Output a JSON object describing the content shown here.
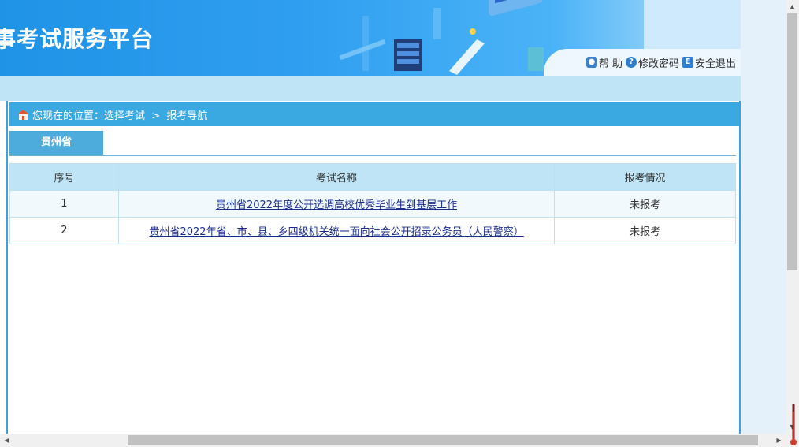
{
  "header": {
    "title": "事考试服务平台",
    "links": [
      {
        "icon": "lock-icon",
        "label": "帮 助"
      },
      {
        "icon": "question-icon",
        "label": "修改密码"
      },
      {
        "icon": "exit-icon",
        "label": "安全退出"
      }
    ]
  },
  "breadcrumb": {
    "icon": "home-icon",
    "label": "您现在的位置：选择考试  >  报考导航"
  },
  "tabs": [
    {
      "label": "贵州省",
      "active": true
    }
  ],
  "table": {
    "columns": [
      "序号",
      "考试名称",
      "报考情况"
    ],
    "rows": [
      {
        "index": "1",
        "name": "贵州省2022年度公开选调高校优秀毕业生到基层工作",
        "status": "未报考"
      },
      {
        "index": "2",
        "name": "贵州省2022年省、市、县、乡四级机关统一面向社会公开招录公务员（人民警察）",
        "status": "未报考"
      }
    ]
  },
  "colors": {
    "banner_blue": "#2f9ef0",
    "crumb_blue": "#3aa9e2",
    "tab_blue": "#4eacdd",
    "header_row": "#bfe4f5",
    "link": "#1a2e8f"
  }
}
